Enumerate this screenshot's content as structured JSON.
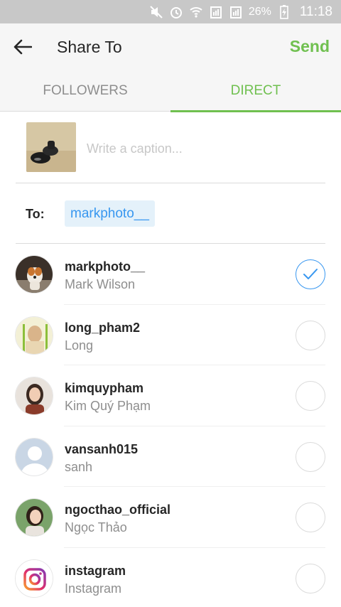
{
  "status_bar": {
    "icons": [
      "mute-icon",
      "alarm-icon",
      "wifi-icon",
      "sim1-signal-icon",
      "sim2-signal-icon",
      "battery-charging-icon"
    ],
    "battery_text": "26%",
    "time": "11:18"
  },
  "header": {
    "back_icon": "back-arrow-icon",
    "title": "Share To",
    "send_label": "Send"
  },
  "tabs": [
    {
      "label": "FOLLOWERS",
      "active": false
    },
    {
      "label": "DIRECT",
      "active": true
    }
  ],
  "caption": {
    "placeholder": "Write a caption..."
  },
  "to": {
    "label": "To:",
    "recipient": "markphoto__"
  },
  "recipients": [
    {
      "username": "markphoto__",
      "full_name": "Mark Wilson",
      "selected": true,
      "avatar": "dog-photo"
    },
    {
      "username": "long_pham2",
      "full_name": "Long",
      "selected": false,
      "avatar": "person-photo"
    },
    {
      "username": "kimquypham",
      "full_name": "Kim Quý Phạm",
      "selected": false,
      "avatar": "person-photo"
    },
    {
      "username": "vansanh015",
      "full_name": "sanh",
      "selected": false,
      "avatar": "default-avatar"
    },
    {
      "username": "ngocthao_official",
      "full_name": "Ngọc Thảo",
      "selected": false,
      "avatar": "person-photo"
    },
    {
      "username": "instagram",
      "full_name": "Instagram",
      "selected": false,
      "avatar": "instagram-logo"
    }
  ],
  "colors": {
    "accent_green": "#70c050",
    "accent_blue": "#3897f0",
    "chip_background": "#e4f1fa",
    "status_bar": "#c8c8c8",
    "header_background": "#f6f6f6"
  }
}
